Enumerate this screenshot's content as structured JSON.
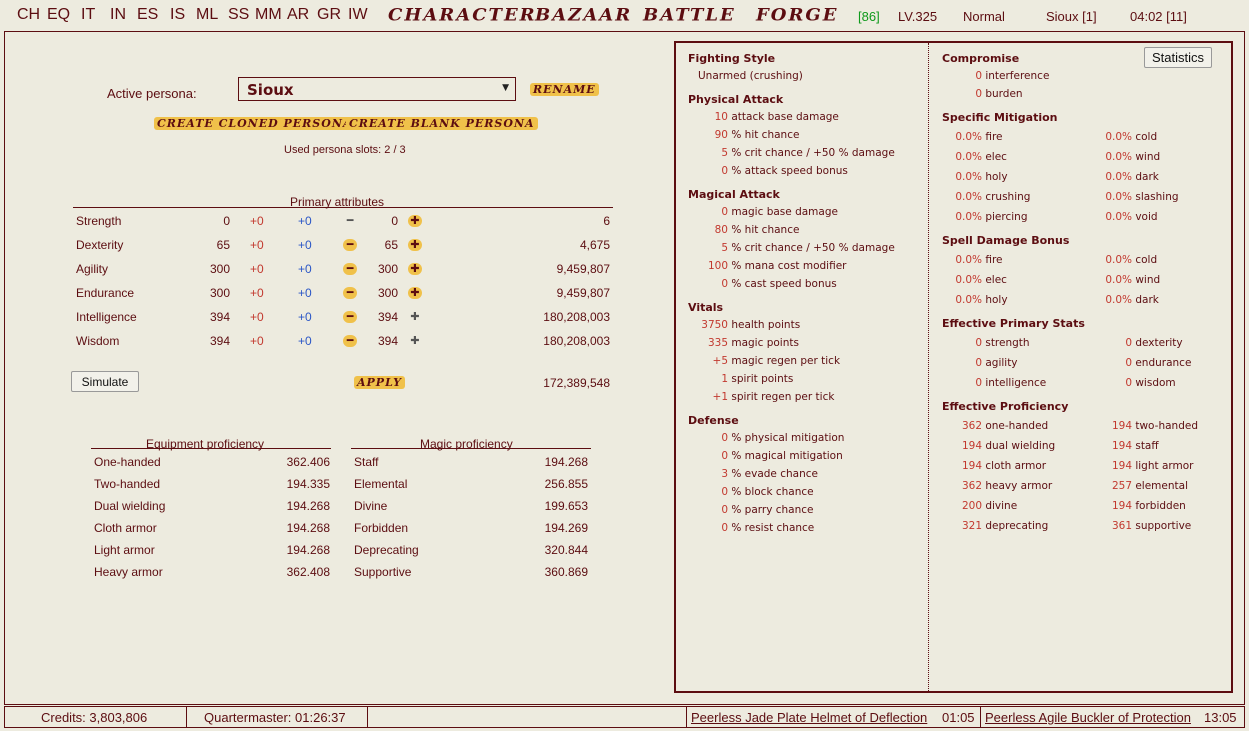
{
  "menu": {
    "short": [
      "CH",
      "EQ",
      "IT",
      "IN",
      "ES",
      "IS",
      "ML",
      "SS",
      "MM",
      "AR",
      "GR",
      "IW"
    ],
    "big": [
      "CHARACTER",
      "BAZAAR",
      "BATTLE",
      "FORGE"
    ],
    "level_bracket": "[86]",
    "level": "LV.325",
    "difficulty": "Normal",
    "persona_name": "Sioux [1]",
    "time": "04:02 [11]"
  },
  "persona": {
    "active_label": "Active persona:",
    "selected": "Sioux",
    "rename": "RENAME",
    "create_cloned": "CREATE CLONED PERSONA",
    "create_blank": "CREATE BLANK PERSONA",
    "slots": "Used persona slots: 2 / 3"
  },
  "attributes": {
    "title": "Primary attributes",
    "rows": [
      {
        "name": "Strength",
        "base": "0",
        "p1": "+0",
        "p2": "+0",
        "val": "0",
        "exp": "6"
      },
      {
        "name": "Dexterity",
        "base": "65",
        "p1": "+0",
        "p2": "+0",
        "val": "65",
        "exp": "4,675"
      },
      {
        "name": "Agility",
        "base": "300",
        "p1": "+0",
        "p2": "+0",
        "val": "300",
        "exp": "9,459,807"
      },
      {
        "name": "Endurance",
        "base": "300",
        "p1": "+0",
        "p2": "+0",
        "val": "300",
        "exp": "9,459,807"
      },
      {
        "name": "Intelligence",
        "base": "394",
        "p1": "+0",
        "p2": "+0",
        "val": "394",
        "exp": "180,208,003"
      },
      {
        "name": "Wisdom",
        "base": "394",
        "p1": "+0",
        "p2": "+0",
        "val": "394",
        "exp": "180,208,003"
      }
    ],
    "simulate": "Simulate",
    "apply": "APPLY",
    "total_exp": "172,389,548"
  },
  "equipment_prof": {
    "title": "Equipment proficiency",
    "rows": [
      {
        "name": "One-handed",
        "val": "362.406"
      },
      {
        "name": "Two-handed",
        "val": "194.335"
      },
      {
        "name": "Dual wielding",
        "val": "194.268"
      },
      {
        "name": "Cloth armor",
        "val": "194.268"
      },
      {
        "name": "Light armor",
        "val": "194.268"
      },
      {
        "name": "Heavy armor",
        "val": "362.408"
      }
    ]
  },
  "magic_prof": {
    "title": "Magic proficiency",
    "rows": [
      {
        "name": "Staff",
        "val": "194.268"
      },
      {
        "name": "Elemental",
        "val": "256.855"
      },
      {
        "name": "Divine",
        "val": "199.653"
      },
      {
        "name": "Forbidden",
        "val": "194.269"
      },
      {
        "name": "Deprecating",
        "val": "320.844"
      },
      {
        "name": "Supportive",
        "val": "360.869"
      }
    ]
  },
  "stats": {
    "statistics_button": "Statistics",
    "fighting_style": {
      "title": "Fighting Style",
      "value": "Unarmed (crushing)"
    },
    "physical_attack": {
      "title": "Physical Attack",
      "rows": [
        {
          "v": "10",
          "t": "attack base damage"
        },
        {
          "v": "90",
          "t": "% hit chance"
        },
        {
          "v": "5",
          "t": "% crit chance / +50 % damage"
        },
        {
          "v": "0",
          "t": "% attack speed bonus"
        }
      ]
    },
    "magical_attack": {
      "title": "Magical Attack",
      "rows": [
        {
          "v": "0",
          "t": "magic base damage"
        },
        {
          "v": "80",
          "t": "% hit chance"
        },
        {
          "v": "5",
          "t": "% crit chance / +50 % damage"
        },
        {
          "v": "100",
          "t": "% mana cost modifier"
        },
        {
          "v": "0",
          "t": "% cast speed bonus"
        }
      ]
    },
    "vitals": {
      "title": "Vitals",
      "rows": [
        {
          "v": "3750",
          "t": "health points"
        },
        {
          "v": "335",
          "t": "magic points"
        },
        {
          "v": "+5",
          "t": "magic regen per tick"
        },
        {
          "v": "1",
          "t": "spirit points"
        },
        {
          "v": "+1",
          "t": "spirit regen per tick"
        }
      ]
    },
    "defense": {
      "title": "Defense",
      "rows": [
        {
          "v": "0",
          "t": "% physical mitigation"
        },
        {
          "v": "0",
          "t": "% magical mitigation"
        },
        {
          "v": "3",
          "t": "% evade chance"
        },
        {
          "v": "0",
          "t": "% block chance"
        },
        {
          "v": "0",
          "t": "% parry chance"
        },
        {
          "v": "0",
          "t": "% resist chance"
        }
      ]
    },
    "compromise": {
      "title": "Compromise",
      "rows": [
        {
          "v": "0",
          "t": "interference"
        },
        {
          "v": "0",
          "t": "burden"
        }
      ]
    },
    "specific_mitigation": {
      "title": "Specific Mitigation",
      "rows": [
        {
          "v": "0.0%",
          "t": "fire"
        },
        {
          "v": "0.0%",
          "t": "cold"
        },
        {
          "v": "0.0%",
          "t": "elec"
        },
        {
          "v": "0.0%",
          "t": "wind"
        },
        {
          "v": "0.0%",
          "t": "holy"
        },
        {
          "v": "0.0%",
          "t": "dark"
        },
        {
          "v": "0.0%",
          "t": "crushing"
        },
        {
          "v": "0.0%",
          "t": "slashing"
        },
        {
          "v": "0.0%",
          "t": "piercing"
        },
        {
          "v": "0.0%",
          "t": "void"
        }
      ]
    },
    "spell_damage": {
      "title": "Spell Damage Bonus",
      "rows": [
        {
          "v": "0.0%",
          "t": "fire"
        },
        {
          "v": "0.0%",
          "t": "cold"
        },
        {
          "v": "0.0%",
          "t": "elec"
        },
        {
          "v": "0.0%",
          "t": "wind"
        },
        {
          "v": "0.0%",
          "t": "holy"
        },
        {
          "v": "0.0%",
          "t": "dark"
        }
      ]
    },
    "effective_primary": {
      "title": "Effective Primary Stats",
      "rows": [
        {
          "v": "0",
          "t": "strength"
        },
        {
          "v": "0",
          "t": "dexterity"
        },
        {
          "v": "0",
          "t": "agility"
        },
        {
          "v": "0",
          "t": "endurance"
        },
        {
          "v": "0",
          "t": "intelligence"
        },
        {
          "v": "0",
          "t": "wisdom"
        }
      ]
    },
    "effective_prof": {
      "title": "Effective Proficiency",
      "rows": [
        {
          "v": "362",
          "t": "one-handed"
        },
        {
          "v": "194",
          "t": "two-handed"
        },
        {
          "v": "194",
          "t": "dual wielding"
        },
        {
          "v": "194",
          "t": "staff"
        },
        {
          "v": "194",
          "t": "cloth armor"
        },
        {
          "v": "194",
          "t": "light armor"
        },
        {
          "v": "362",
          "t": "heavy armor"
        },
        {
          "v": "257",
          "t": "elemental"
        },
        {
          "v": "200",
          "t": "divine"
        },
        {
          "v": "194",
          "t": "forbidden"
        },
        {
          "v": "321",
          "t": "deprecating"
        },
        {
          "v": "361",
          "t": "supportive"
        }
      ]
    }
  },
  "bottom": {
    "credits": "Credits: 3,803,806",
    "quartermaster": "Quartermaster: 01:26:37",
    "item1": "Peerless Jade Plate Helmet of Deflection",
    "item1_time": "01:05",
    "item2": "Peerless Agile Buckler of Protection",
    "item2_time": "13:05"
  }
}
